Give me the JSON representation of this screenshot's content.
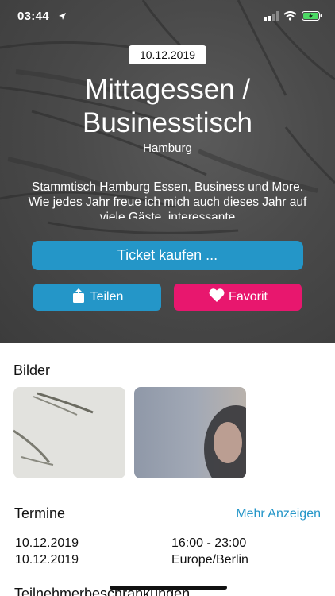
{
  "status_bar": {
    "time": "03:44",
    "icons": [
      "location-arrow-icon",
      "signal-icon",
      "wifi-icon",
      "battery-icon"
    ],
    "battery_color": "#4cd964"
  },
  "event": {
    "date": "10.12.2019",
    "title_line1": "Mittagessen /",
    "title_line2": "Businesstisch",
    "city": "Hamburg",
    "description": "Stammtisch Hamburg Essen, Business und More. Wie jedes Jahr freue ich mich auch dieses Jahr auf viele Gäste, interessante"
  },
  "actions": {
    "ticket_label": "Ticket kaufen ...",
    "share_label": "Teilen",
    "share_icon": "share-icon",
    "favorite_label": "Favorit",
    "favorite_icon": "heart-icon"
  },
  "images_section": {
    "title": "Bilder"
  },
  "dates_section": {
    "title": "Termine",
    "more_label": "Mehr Anzeigen",
    "rows": [
      {
        "left": "10.12.2019",
        "right": "16:00 - 23:00"
      },
      {
        "left": "10.12.2019",
        "right": "Europe/Berlin"
      }
    ]
  },
  "next_section": {
    "title": "Teilnehmerbeschränkungen"
  },
  "colors": {
    "primary_blue": "#2496c8",
    "favorite_pink": "#e8176e",
    "hero_bg": "#4a4a4a"
  }
}
